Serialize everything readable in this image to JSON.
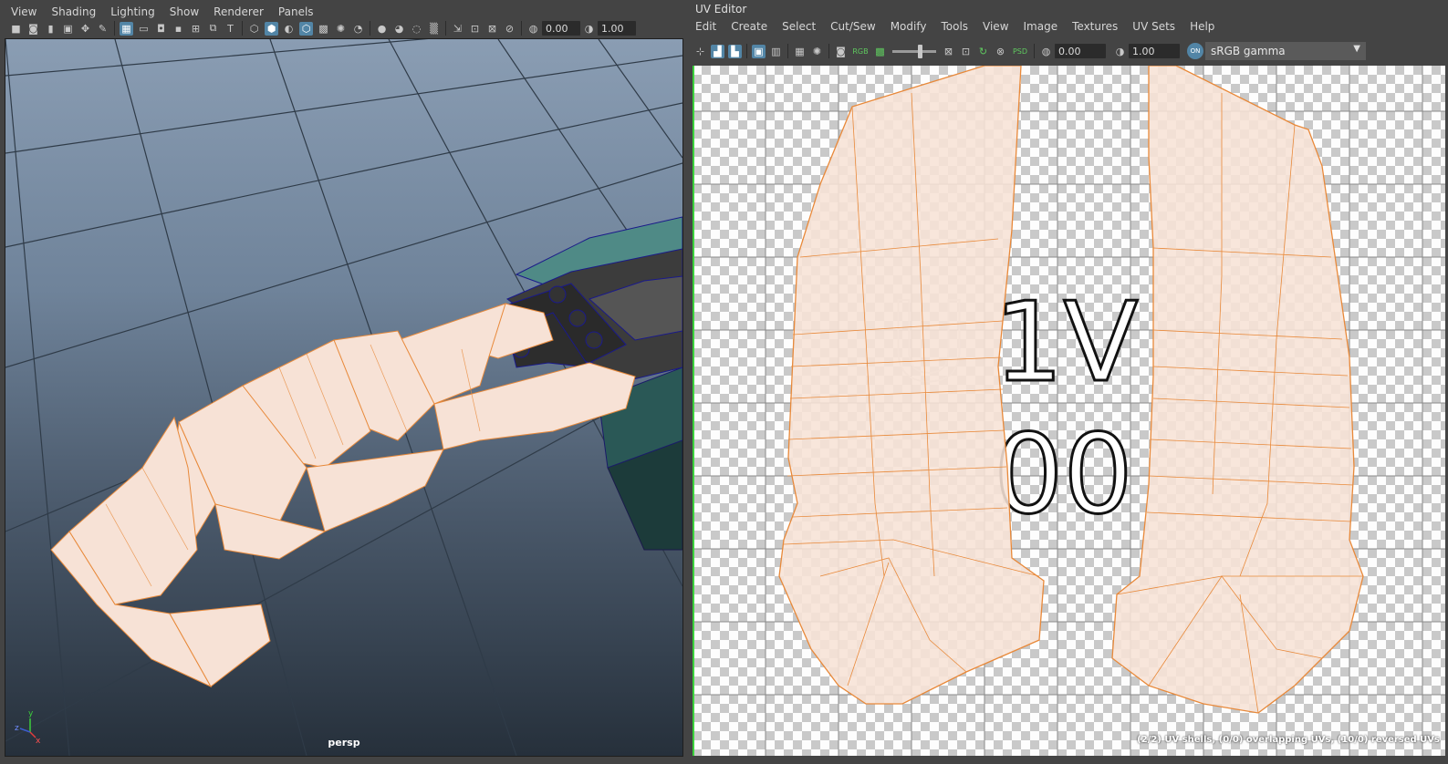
{
  "viewport_panel": {
    "menu": [
      "View",
      "Shading",
      "Lighting",
      "Show",
      "Renderer",
      "Panels"
    ],
    "toolbar": {
      "exposure_value": "0.00",
      "gamma_value": "1.00"
    },
    "camera_label": "persp",
    "axis_labels": {
      "x": "x",
      "y": "y",
      "z": "z"
    }
  },
  "uv_editor": {
    "title": "UV Editor",
    "menu": [
      "Edit",
      "Create",
      "Select",
      "Cut/Sew",
      "Modify",
      "Tools",
      "View",
      "Image",
      "Textures",
      "UV Sets",
      "Help"
    ],
    "toolbar": {
      "exposure_value": "0.00",
      "gamma_value": "1.00",
      "color_space": "sRGB gamma",
      "rgb_label": "RGB",
      "psd_label": "PSD",
      "on_label": "ON"
    },
    "canvas_text": {
      "line1": "1V",
      "line2": "00"
    },
    "status_text": "(2/2) UV shells, (0/0) overlapping UVs, (10/0) reversed UVs"
  },
  "colors": {
    "accent": "#5285a6",
    "uv_shell_fill": "#f7e2d6",
    "uv_shell_edge": "#e8893a",
    "mesh_dark": "#3c3c3c",
    "mesh_teal": "#4f8a86"
  }
}
